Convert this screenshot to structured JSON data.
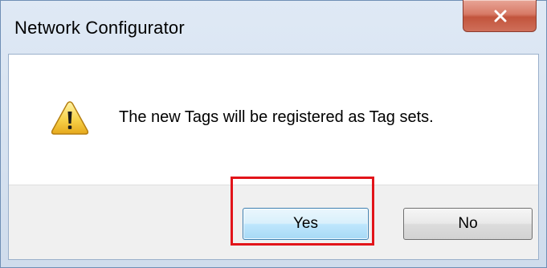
{
  "window": {
    "title": "Network Configurator",
    "close_icon": "close-icon"
  },
  "dialog": {
    "icon": "warning-icon",
    "message": "The new Tags will be registered as Tag sets."
  },
  "buttons": {
    "yes_label": "Yes",
    "no_label": "No"
  },
  "annotation": {
    "highlighted_button": "Yes",
    "highlight_color": "#e2141a"
  }
}
